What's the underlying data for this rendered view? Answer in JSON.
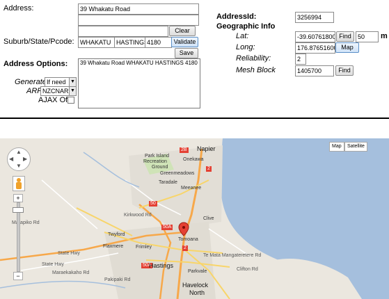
{
  "form": {
    "address_label": "Address:",
    "address_line1": "39 Whakatu Road",
    "address_line2": "",
    "address_line3": "",
    "clear_label": "Clear",
    "suburb_label": "Suburb/State/Pcode:",
    "suburb": "WHAKATU",
    "state": "HASTINGS",
    "pcode": "4180",
    "validate_label": "Validate",
    "save_label": "Save",
    "options_heading": "Address Options:",
    "options_text": "39 Whakatu Road WHAKATU HASTINGS 4180",
    "generate_label": "Generate:",
    "generate_value": "If need",
    "arf_label": "ARF:",
    "arf_value": "NZCNAR",
    "ajax_label": "AJAX Off:"
  },
  "info": {
    "address_id_label": "AddressId:",
    "address_id": "3256994",
    "geo_heading": "Geographic Info",
    "lat_label": "Lat:",
    "lat": "-39.607618000",
    "find_label": "Find",
    "radius": "50",
    "radius_unit": "m",
    "long_label": "Long:",
    "long": "176.876516000",
    "map_label": "Map",
    "reliability_label": "Reliability:",
    "reliability": "2",
    "mesh_label": "Mesh Block",
    "mesh": "1405700",
    "find2_label": "Find"
  },
  "map": {
    "type_map": "Map",
    "type_satellite": "Satellite",
    "zoom_in": "+",
    "zoom_out": "−",
    "labels": {
      "napier": "Napier",
      "park_island": "Park Island",
      "recreation": "Recreation",
      "ground": "Ground",
      "onekawa": "Onekawa",
      "greenmeadows": "Greenmeadows",
      "taradale": "Taradale",
      "meeanee": "Meeanee",
      "clive": "Clive",
      "twyford": "Twyford",
      "tomoana": "Tomoana",
      "flaxmere": "Flaxmere",
      "frimley": "Frimley",
      "hastings": "Hastings",
      "parkvale": "Parkvale",
      "havelock": "Havelock",
      "north": "North",
      "state_hwy_1": "State Hwy",
      "state_hwy_2": "State Hwy",
      "maraekakaho": "Maraekakaho Rd",
      "marapiko": "Marapiko Rd",
      "kirkwood": "Kirkwood Rd",
      "pakipaki": "Pakipaki Rd",
      "te_mata": "Te Mata Mangateretere Rd",
      "clifton": "Clifton Rd",
      "shield_2b": "2B",
      "shield_2": "2",
      "shield_50a": "50A",
      "shield_50": "50",
      "shield_2c": "2"
    }
  },
  "colors": {
    "sea": "#a5bfdd",
    "land": "#ebe7df",
    "yellow_road": "#f8d56a",
    "orange_road": "#f7a84a",
    "marker": "#e44033"
  }
}
